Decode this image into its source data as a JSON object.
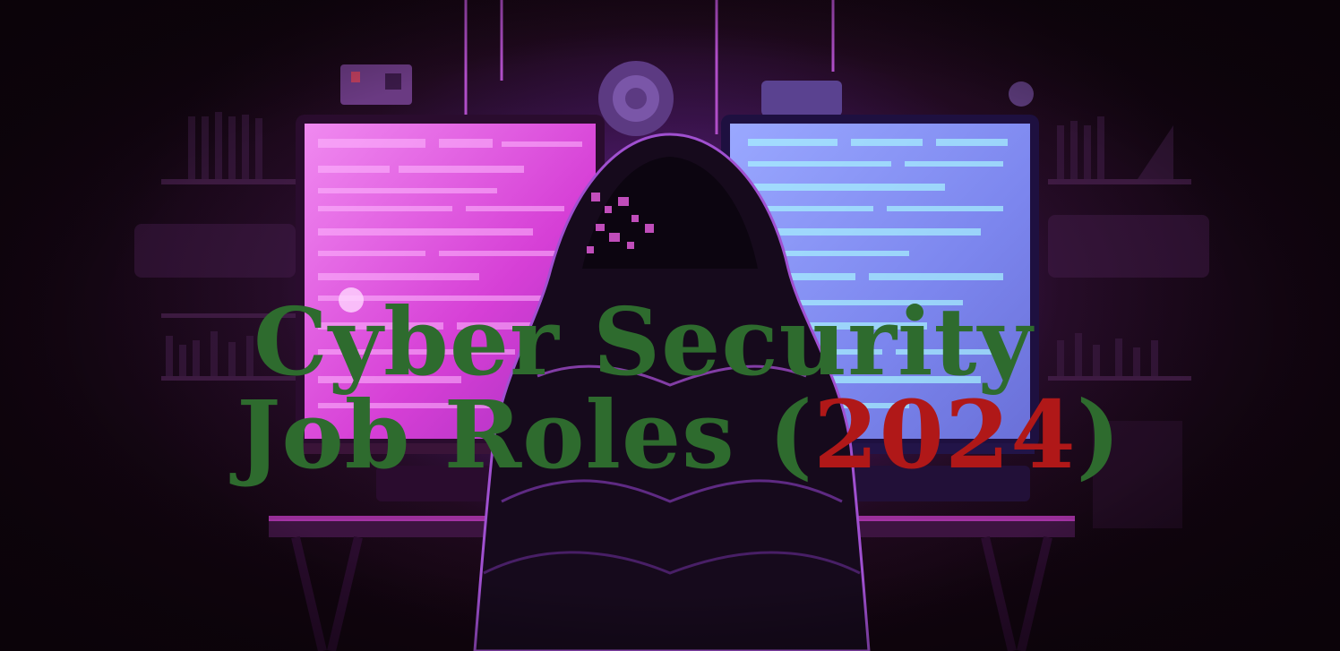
{
  "title": {
    "line1": "Cyber Security",
    "line2_prefix": "Job Roles (",
    "line2_year": "2024",
    "line2_suffix": ")"
  },
  "colors": {
    "title_green": "#2e6b2e",
    "year_red": "#b01818",
    "left_screen": "#d84ad8",
    "right_screen": "#7c8cf0",
    "background": "#14070f"
  }
}
